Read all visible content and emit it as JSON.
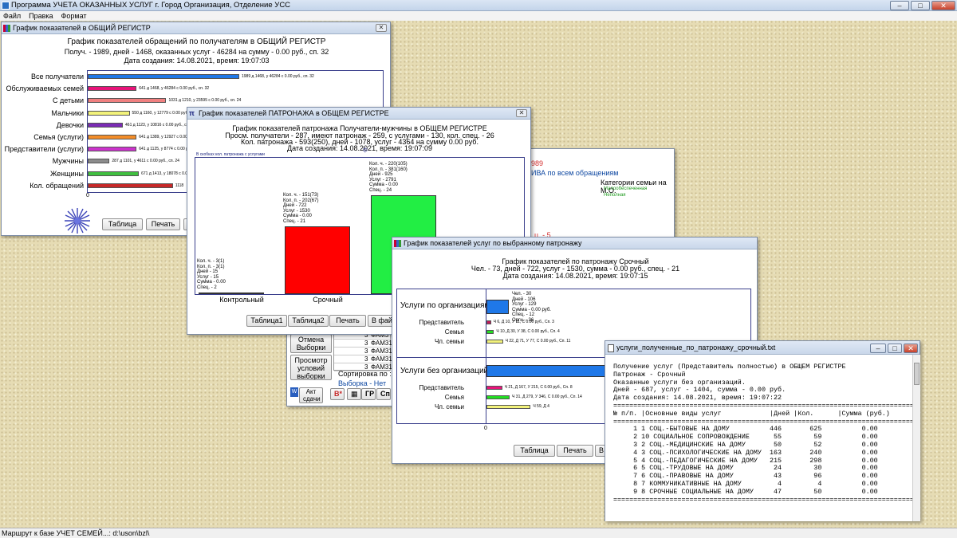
{
  "app": {
    "title": "Программа УЧЕТА ОКАЗАННЫХ УСЛУГ г. Город Организация, Отделение УСС",
    "menu": [
      "Файл",
      "Правка",
      "Формат"
    ],
    "status": "Маршрут к базе УЧЕТ СЕМЕЙ...: d:\\uson\\bzl\\"
  },
  "win1": {
    "title": "График показателей в ОБЩИЙ РЕГИСТР",
    "h1": "График показателей обращений по получателям в ОБЩИЙ РЕГИСТР",
    "h2": "Получ. - 1989, дней - 1468, оказанных услуг - 46284 на сумму - 0.00 руб., сп. 32",
    "h3": "Дата создания: 14.08.2021, время: 19:07:03",
    "zero": "0",
    "buttons": {
      "table": "Таблица",
      "print": "Печать",
      "file": "В"
    },
    "chart_data": {
      "type": "bar",
      "orientation": "horizontal",
      "categories": [
        "Все получатели",
        "Обслуживаемых семей",
        "С детьми",
        "Мальчики",
        "Девочки",
        "Семья (услуги)",
        "Представители (услуги)",
        "Мужчины",
        "Женщины",
        "Кол. обращений"
      ],
      "values": [
        1989,
        641,
        1031,
        550,
        461,
        641,
        641,
        287,
        671,
        1118
      ],
      "labels": [
        "1989 д 1468, у 46284 с 0.00 руб., сп. 32",
        "641 д 1468, у 46284 с 0.00 руб., сп. 32",
        "1031 д 1210, у 23595 с 0.00 руб., сп. 24",
        "550 д 1160, у 12779 с 0.00 руб., сп. 24",
        "461 д 1123, у 10816 с 0.00 руб., сп. 24",
        "641 д 1389, у 12927 с 0.00 руб., сп. 24",
        "641 д 1125, у 8774 с 0.00 руб., сп. 24",
        "287 д 1101, у 4611 с 0.00 руб., сп. 24",
        "671 д 1413, у 18078 с 0.00 руб., сп. 24",
        "1118"
      ],
      "colors": [
        "#1f78e8",
        "#e8147a",
        "#f08080",
        "#f2f27a",
        "#7b2bb5",
        "#f28c28",
        "#cc33cc",
        "#8c8c8c",
        "#3fbf3f",
        "#c62828"
      ],
      "xlim": [
        0,
        1989
      ]
    }
  },
  "win3": {
    "title": "",
    "red": "989",
    "blue": "ИВА по всем обращениям",
    "cat_title": "Категории семьи на М.О.",
    "cat1": "Малообеспеченная",
    "cat2": "Неполная",
    "spec": "ц. - 5",
    "rows": [
      {
        "n": "3",
        "t": "ФАМ3"
      },
      {
        "n": "3",
        "t": "ФАМ310"
      },
      {
        "n": "3",
        "t": "ФАМ31"
      },
      {
        "n": "3",
        "t": "ФАМ31"
      },
      {
        "n": "3",
        "t": "ФАМ31:"
      }
    ],
    "btn_cancel": "Отмена Выборки",
    "btn_view": "Просмотр условий выборки",
    "sort_label": "Сортировка по :",
    "sort_value": "Но",
    "sample": "Выборка - Нет",
    "btn_act": "Акт сдачи",
    "btn_b": "В*",
    "btn_gr": "ГР",
    "btn_sp": "Сп."
  },
  "win2": {
    "title": "График показателей ПАТРОНАЖА в ОБЩЕМ РЕГИСТРЕ",
    "h1": "График показателей патронажа Получатели-мужчины в ОБЩЕМ РЕГИСТРЕ",
    "h2": "Просм. получатели - 287, имеют патронаж - 259, с услугами - 130, кол. спец. - 26",
    "h3": "Кол. патронажа - 593(250), дней - 1078, услуг - 4364 на сумму 0.00 руб.",
    "h4": "Дата создания: 14.08.2021, время: 19:07:09",
    "subnote": "В скобках кол. патронажа с услугами",
    "marker": "ф",
    "buttons": [
      "Таблица1",
      "Таблица2",
      "Печать",
      "В фай"
    ],
    "chart_data": {
      "type": "bar",
      "categories": [
        "Контрольный",
        "Срочный",
        "Т"
      ],
      "values": [
        3,
        151,
        220
      ],
      "colors": [
        "#1f3fbf",
        "#ff0000",
        "#22ee44"
      ],
      "labels": [
        "Кол. ч. - 3(1)\nКол. п. - 3(1)\nДней - 15\nУслуг - 15\nСумма - 0.00\nСпец. - 2",
        "Кол. ч. - 151(73)\nКол. п. - 202(67)\nДней - 722\nУслуг - 1530\nСумма - 0.00\nСпец. - 21",
        "Кол. ч. - 220(105)\nКол. п. - 381(160)\nДней - 925\nУслуг - 2791\nСумма - 0.00\nСпец. - 24"
      ],
      "ylim": [
        0,
        285
      ]
    }
  },
  "win4": {
    "title": "График показателей услуг по выбранному патронажу",
    "h1": "График показателей по патронажу Срочный",
    "h2": "Чел. - 73, дней - 722, услуг - 1530, сумма - 0.00 руб., спец. - 21",
    "h3": "Дата создания: 14.08.2021, время: 19:07:15",
    "group1": "Услуги по организациям",
    "group2": "Услуги без организаций",
    "zero": "0",
    "top_label": "Чел. - 30\nДней - 106\nУслуг - 129\nСумма - 0.00 руб.\nСпец. - 12\nОргн. - 36",
    "buttons": [
      "Таблица",
      "Печать",
      "В"
    ],
    "chart_data": {
      "type": "bar",
      "orientation": "horizontal",
      "series": [
        {
          "name": "Услуги по организациям",
          "categories": [
            "Услуги по организациям",
            "Представитель",
            "Семья",
            "Чл. семьи"
          ],
          "values": [
            30,
            6,
            10,
            22
          ],
          "labels": [
            "",
            "Ч 6, Д 10, У 11, С 0.00 руб., Сп. 3",
            "Ч 10, Д 30, У 38, С 0.00 руб., Сп. 4",
            "Ч 22, Д 71, У 77, С 0.00 руб., Сп. 11"
          ],
          "colors": [
            "#1f78e8",
            "#c2185b",
            "#22dd22",
            "#f2f27a"
          ]
        },
        {
          "name": "Услуги без организаций",
          "categories": [
            "Услуги без организаций",
            "Представитель",
            "Семья",
            "Чл. семьи"
          ],
          "values": [
            160,
            21,
            31,
            59
          ],
          "labels": [
            "",
            "Ч 21, Д 167, У 215, С 0.00 руб., Сп. 8",
            "Ч 31, Д 279, У 346, С 0.00 руб., Сп. 14",
            "Ч 59, Д 4"
          ],
          "colors": [
            "#1f78e8",
            "#e8147a",
            "#22dd22",
            "#f2f27a"
          ]
        }
      ],
      "xlim": [
        0,
        160
      ]
    }
  },
  "win5": {
    "title": "услуги_полученные_по_патронажу_срочный.txt",
    "lines": [
      "Получение услуг (Представитель полностью) в ОБЩЕМ РЕГИСТРЕ",
      "Патронаж - Срочный",
      "Оказанные услуги без организаций.",
      "Дней - 687, услуг - 1404, сумма - 0.00 руб.",
      "Дата создания: 14.08.2021, время: 19:07:22",
      "===========================================================================",
      "№ п/п. |Основные виды услуг            |Дней |Кол.      |Сумма (руб.)",
      "===========================================================================",
      "     1 1 СОЦ.-БЫТОВЫЕ НА ДОМУ          446       625          0.00",
      "     2 10 СОЦИАЛЬНОЕ СОПРОВОЖДЕНИЕ      55        59          0.00",
      "     3 2 СОЦ.-МЕДИЦИНСКИЕ НА ДОМУ       50        52          0.00",
      "     4 3 СОЦ.-ПСИХОЛОГИЧЕСКИЕ НА ДОМУ  163       240          0.00",
      "     5 4 СОЦ.-ПЕДАГОГИЧЕСКИЕ НА ДОМУ   215       298          0.00",
      "     6 5 СОЦ.-ТРУДОВЫЕ НА ДОМУ          24        30          0.00",
      "     7 6 СОЦ.-ПРАВОВЫЕ НА ДОМУ          43        96          0.00",
      "     8 7 КОММУНИКАТИВНЫЕ НА ДОМУ         4         4          0.00",
      "     9 8 СРОЧНЫЕ СОЦИАЛЬНЫЕ НА ДОМУ     47        50          0.00",
      "==========================================================================="
    ]
  }
}
